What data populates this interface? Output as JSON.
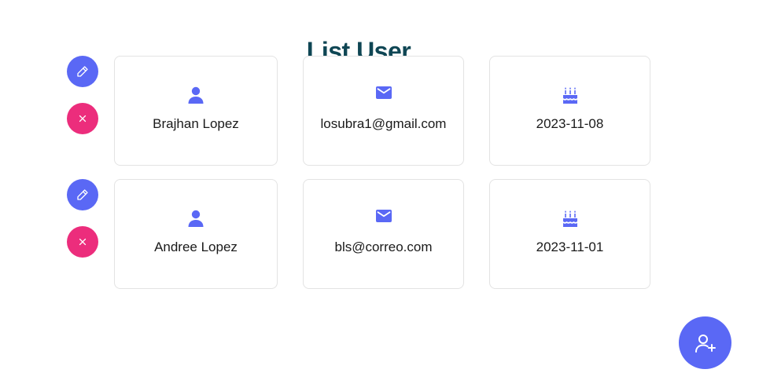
{
  "page": {
    "title": "List User"
  },
  "users": [
    {
      "name": "Brajhan Lopez",
      "email": "losubra1@gmail.com",
      "birthday": "2023-11-08"
    },
    {
      "name": "Andree Lopez",
      "email": "bls@correo.com",
      "birthday": "2023-11-01"
    }
  ],
  "icons": {
    "edit": "pencil-icon",
    "delete": "close-icon",
    "name": "person-icon",
    "email": "mail-icon",
    "birthday": "cake-icon",
    "add": "add-user-icon"
  },
  "colors": {
    "accent": "#5a68f5",
    "danger": "#ec2d7c",
    "title": "#0f4654"
  }
}
